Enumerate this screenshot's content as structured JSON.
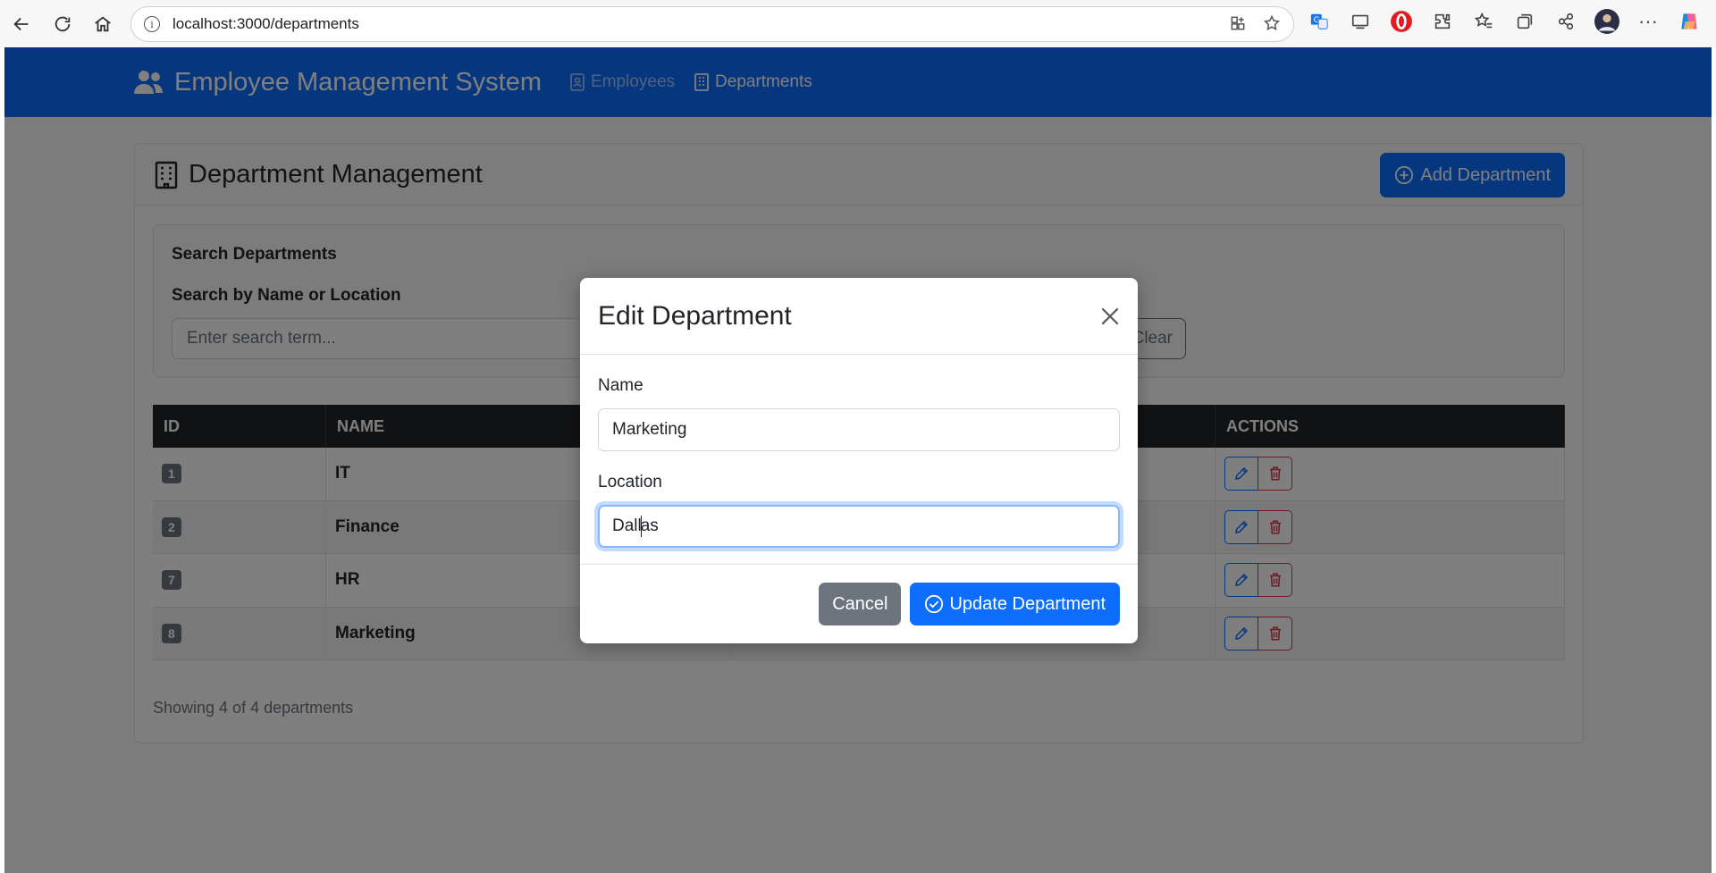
{
  "browser": {
    "url": "localhost:3000/departments"
  },
  "navbar": {
    "brand": "Employee Management System",
    "links": [
      "Employees",
      "Departments"
    ]
  },
  "card": {
    "title": "Department Management",
    "add_button": "Add Department"
  },
  "search": {
    "title": "Search Departments",
    "label": "Search by Name or Location",
    "placeholder": "Enter search term...",
    "clear_button": "Clear"
  },
  "table": {
    "headers": [
      "ID",
      "NAME",
      "",
      "ACTIONS"
    ],
    "rows": [
      {
        "id": "1",
        "name": "IT",
        "location": ""
      },
      {
        "id": "2",
        "name": "Finance",
        "location": ""
      },
      {
        "id": "7",
        "name": "HR",
        "location": ""
      },
      {
        "id": "8",
        "name": "Marketing",
        "location": ""
      }
    ]
  },
  "footer": {
    "showing": "Showing 4 of 4 departments"
  },
  "modal": {
    "title": "Edit Department",
    "name_label": "Name",
    "name_value": "Marketing",
    "location_label": "Location",
    "location_value_before_caret": "Dall",
    "location_value_after_caret": "as",
    "cancel_button": "Cancel",
    "update_button": "Update Department"
  },
  "colors": {
    "primary": "#0d6efd",
    "danger": "#dc3545",
    "secondary": "#6c757d",
    "dark": "#212529"
  }
}
